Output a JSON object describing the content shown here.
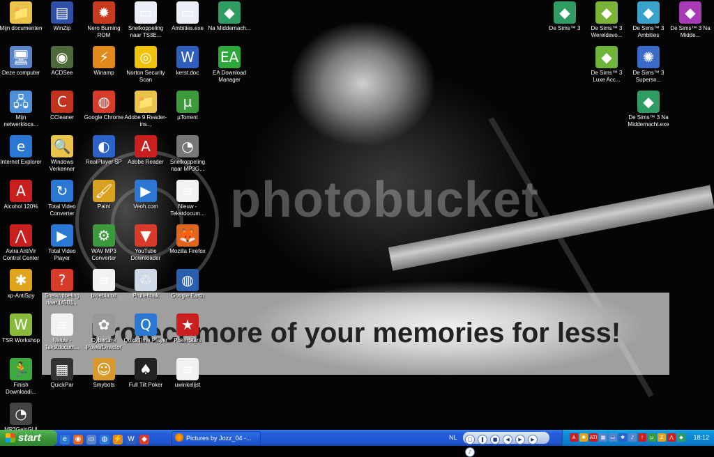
{
  "wallpaper": {
    "watermark": "photobucket",
    "promo": "Protect more of your memories for less!"
  },
  "desktop_icons_left": [
    {
      "name": "mijn-documenten",
      "label": "Mijn documenten",
      "icon": "folder-icon",
      "color": "#e9c34a",
      "glyph": "📁"
    },
    {
      "name": "winzip",
      "label": "WinZip",
      "icon": "winzip-icon",
      "color": "#2f4fa8",
      "glyph": "▤"
    },
    {
      "name": "nero-burning-rom",
      "label": "Nero Burning ROM",
      "icon": "nero-icon",
      "color": "#c83a1e",
      "glyph": "✹"
    },
    {
      "name": "snelkoppeling-ts3e",
      "label": "Snelkoppeling naar TS3E...",
      "icon": "window-icon",
      "color": "#e9eef7",
      "glyph": "▭"
    },
    {
      "name": "ambities-exe",
      "label": "Ambities.exe",
      "icon": "window-icon",
      "color": "#e9eef7",
      "glyph": "▭"
    },
    {
      "name": "na-middernacht",
      "label": "Na Middernach...",
      "icon": "sims-icon",
      "color": "#2f9d63",
      "glyph": "◆"
    },
    {
      "name": "deze-computer",
      "label": "Deze computer",
      "icon": "computer-icon",
      "color": "#5a84c9",
      "glyph": "🖥"
    },
    {
      "name": "acdsee",
      "label": "ACDSee",
      "icon": "acdsee-icon",
      "color": "#4f6a3a",
      "glyph": "◉"
    },
    {
      "name": "winamp",
      "label": "Winamp",
      "icon": "winamp-icon",
      "color": "#e08a1c",
      "glyph": "⚡"
    },
    {
      "name": "norton-security-scan",
      "label": "Norton Security Scan",
      "icon": "norton-icon",
      "color": "#f0c20a",
      "glyph": "◎"
    },
    {
      "name": "kerst-doc",
      "label": "kerst.doc",
      "icon": "word-doc-icon",
      "color": "#2f5fbd",
      "glyph": "W"
    },
    {
      "name": "ea-download-manager",
      "label": "EA Download Manager",
      "icon": "ea-icon",
      "color": "#2ea83a",
      "glyph": "EA"
    },
    {
      "name": "mijn-netwerklocaties",
      "label": "Mijn netwerkloca...",
      "icon": "network-icon",
      "color": "#4d8fd9",
      "glyph": "🖧"
    },
    {
      "name": "ccleaner",
      "label": "CCleaner",
      "icon": "ccleaner-icon",
      "color": "#c2331f",
      "glyph": "C"
    },
    {
      "name": "google-chrome",
      "label": "Google Chrome",
      "icon": "chrome-icon",
      "color": "#d93b2b",
      "glyph": "◍"
    },
    {
      "name": "adobe-9-reader-install",
      "label": "Adobe 9 Reader-ins...",
      "icon": "folder-icon",
      "color": "#e9c34a",
      "glyph": "📁"
    },
    {
      "name": "utorrent",
      "label": "µTorrent",
      "icon": "utorrent-icon",
      "color": "#3c9a3c",
      "glyph": "µ"
    },
    {
      "name": "internet-explorer",
      "label": "Internet Explorer",
      "icon": "ie-icon",
      "color": "#2a78d4",
      "glyph": "e"
    },
    {
      "name": "windows-verkenner",
      "label": "Windows Verkenner",
      "icon": "explorer-icon",
      "color": "#e9c34a",
      "glyph": "🔍"
    },
    {
      "name": "realplayer-sp",
      "label": "RealPlayer SP",
      "icon": "realplayer-icon",
      "color": "#2a62c9",
      "glyph": "◐"
    },
    {
      "name": "adobe-reader",
      "label": "Adobe Reader",
      "icon": "adobe-reader-icon",
      "color": "#c91f1f",
      "glyph": "A"
    },
    {
      "name": "snelkoppeling-mp3g",
      "label": "Snelkoppeling naar MP3G...",
      "icon": "gauge-icon",
      "color": "#777777",
      "glyph": "◔"
    },
    {
      "name": "alcohol-120",
      "label": "Alcohol 120%",
      "icon": "alcohol-icon",
      "color": "#c91f1f",
      "glyph": "A"
    },
    {
      "name": "total-video-converter",
      "label": "Total Video Converter",
      "icon": "converter-icon",
      "color": "#2a78d4",
      "glyph": "↻"
    },
    {
      "name": "paint",
      "label": "Paint",
      "icon": "paint-icon",
      "color": "#d8a11f",
      "glyph": "🖌"
    },
    {
      "name": "veoh-com",
      "label": "Veoh.com",
      "icon": "veoh-icon",
      "color": "#2a78d4",
      "glyph": "▶"
    },
    {
      "name": "nieuw-tekstdocument",
      "label": "Nieuw - Tekstdocum...",
      "icon": "text-doc-icon",
      "color": "#f2f2f2",
      "glyph": "≡"
    },
    {
      "name": "avira-antivir",
      "label": "Avira AntiVir Control Center",
      "icon": "avira-icon",
      "color": "#c91f1f",
      "glyph": "⋀"
    },
    {
      "name": "total-video-player",
      "label": "Total Video Player",
      "icon": "player-icon",
      "color": "#2a78d4",
      "glyph": "▶"
    },
    {
      "name": "wav-mp3-converter",
      "label": "WAV MP3 Converter",
      "icon": "gear-icon",
      "color": "#3c9a3c",
      "glyph": "⚙"
    },
    {
      "name": "youtube-downloader",
      "label": "YouTube Downloader",
      "icon": "youtube-icon",
      "color": "#d93b2b",
      "glyph": "▼"
    },
    {
      "name": "mozilla-firefox",
      "label": "Mozilla Firefox",
      "icon": "firefox-icon",
      "color": "#e2651c",
      "glyph": "🦊"
    },
    {
      "name": "xp-antispy",
      "label": "xp-AntiSpy",
      "icon": "antispy-icon",
      "color": "#e0a51c",
      "glyph": "✱"
    },
    {
      "name": "snelkoppeling-usb",
      "label": "Snelkoppeling naar USB1...",
      "icon": "shortcut-icon",
      "color": "#d93b2b",
      "glyph": "?"
    },
    {
      "name": "bloebla-txt",
      "label": "bloebla.txt",
      "icon": "text-doc-icon",
      "color": "#f2f2f2",
      "glyph": "≡"
    },
    {
      "name": "prullenbak",
      "label": "Prullenbak",
      "icon": "recycle-bin-icon",
      "color": "#cfd8e6",
      "glyph": "♲"
    },
    {
      "name": "google-earth",
      "label": "Google Earth",
      "icon": "earth-icon",
      "color": "#2a5fb0",
      "glyph": "◍"
    },
    {
      "name": "tsr-workshop",
      "label": "TSR Workshop",
      "icon": "workshop-icon",
      "color": "#8aba3a",
      "glyph": "W"
    },
    {
      "name": "nieuw-tekstdocument-2",
      "label": "Nieuw - Tekstdocum...",
      "icon": "text-doc-icon",
      "color": "#f2f2f2",
      "glyph": "≡"
    },
    {
      "name": "cyberlink-powerdirector",
      "label": "CyberLink PowerDirector",
      "icon": "powerdirector-icon",
      "color": "#999999",
      "glyph": "✿"
    },
    {
      "name": "quicktime-player",
      "label": "QuickTime Player",
      "icon": "quicktime-icon",
      "color": "#2a78d4",
      "glyph": "Q"
    },
    {
      "name": "pokerstars",
      "label": "PokerStars",
      "icon": "pokerstars-icon",
      "color": "#c91f1f",
      "glyph": "★"
    },
    {
      "name": "finish-downloading",
      "label": "Finish Downloadi...",
      "icon": "finish-icon",
      "color": "#3caa3c",
      "glyph": "🏃"
    },
    {
      "name": "quickpar",
      "label": "QuickPar",
      "icon": "quickpar-icon",
      "color": "#333333",
      "glyph": "▦"
    },
    {
      "name": "smybots",
      "label": "Smybots",
      "icon": "smybots-icon",
      "color": "#d89a2a",
      "glyph": "☺"
    },
    {
      "name": "full-tilt-poker",
      "label": "Full Tilt Poker",
      "icon": "fulltilt-icon",
      "color": "#222222",
      "glyph": "♠"
    },
    {
      "name": "uwinkelijst",
      "label": "uwinkelijst",
      "icon": "text-doc-icon",
      "color": "#f2f2f2",
      "glyph": "≡"
    },
    {
      "name": "mp3gain",
      "label": "MP3GainGUI",
      "icon": "mp3gain-icon",
      "color": "#444444",
      "glyph": "◔"
    }
  ],
  "desktop_icons_right": [
    {
      "name": "de-sims-3",
      "label": "De Sims™ 3",
      "icon": "sims-icon",
      "color": "#2f9d63",
      "glyph": "◆"
    },
    {
      "name": "de-sims-3-wereldavonturen",
      "label": "De Sims™ 3 Wereldavo...",
      "icon": "sims-icon",
      "color": "#7ab53a",
      "glyph": "◆"
    },
    {
      "name": "de-sims-3-ambities",
      "label": "De Sims™ 3 Ambities",
      "icon": "sims-icon",
      "color": "#3aa3c9",
      "glyph": "◆"
    },
    {
      "name": "de-sims-3-na-middernacht",
      "label": "De Sims™ 3 Na Midde...",
      "icon": "sims-icon",
      "color": "#a83ab5",
      "glyph": "◆"
    },
    {
      "name": "de-sims-3-luxe",
      "label": "De Sims™ 3 Luxe Acc...",
      "icon": "sims-icon",
      "color": "#6fb53a",
      "glyph": "◆"
    },
    {
      "name": "de-sims-3-supersn",
      "label": "De Sims™ 3 Supersn...",
      "icon": "sims-icon",
      "color": "#3a6bc9",
      "glyph": "✺"
    },
    {
      "name": "de-sims-3-na-middernacht-exe",
      "label": "De Sims™ 3 Na Middernacht.exe",
      "icon": "sims-icon",
      "color": "#2f9d63",
      "glyph": "◆"
    }
  ],
  "taskbar": {
    "start_label": "start",
    "task_item": "Pictures by Jozz_04 -...",
    "language": "NL",
    "clock": "18:12",
    "quick_launch": [
      {
        "name": "ql-ie",
        "icon": "ie-icon",
        "color": "#2a78d4",
        "glyph": "e"
      },
      {
        "name": "ql-firefox",
        "icon": "firefox-icon",
        "color": "#e2651c",
        "glyph": "◉"
      },
      {
        "name": "ql-desktop",
        "icon": "desktop-icon",
        "color": "#5a84c9",
        "glyph": "▭"
      },
      {
        "name": "ql-chrome",
        "icon": "chrome-icon",
        "color": "#2a78d4",
        "glyph": "◍"
      },
      {
        "name": "ql-winamp",
        "icon": "winamp-icon",
        "color": "#e08a1c",
        "glyph": "⚡"
      },
      {
        "name": "ql-word",
        "icon": "word-doc-icon",
        "color": "#2f5fbd",
        "glyph": "W"
      },
      {
        "name": "ql-media",
        "icon": "media-icon",
        "color": "#d93b2b",
        "glyph": "◆"
      }
    ],
    "media_controls": [
      {
        "name": "media-restore-icon",
        "glyph": "□"
      },
      {
        "name": "media-pause-icon",
        "glyph": "❚"
      },
      {
        "name": "media-stop-icon",
        "glyph": "■"
      },
      {
        "name": "media-prev-icon",
        "glyph": "◀"
      },
      {
        "name": "media-play-icon",
        "glyph": "▶"
      },
      {
        "name": "media-next-icon",
        "glyph": "▶"
      },
      {
        "name": "media-volume-icon",
        "glyph": "♪"
      }
    ],
    "tray_icons": [
      {
        "name": "tray-alcohol-icon",
        "color": "#c91f1f",
        "glyph": "A"
      },
      {
        "name": "tray-antispy-icon",
        "color": "#e0a51c",
        "glyph": "✱"
      },
      {
        "name": "tray-ati-icon",
        "color": "#c91f1f",
        "glyph": "ATI"
      },
      {
        "name": "tray-network-icon",
        "color": "#5a84c9",
        "glyph": "▦"
      },
      {
        "name": "tray-display-icon",
        "color": "#5a84c9",
        "glyph": "▭"
      },
      {
        "name": "tray-bluetooth-icon",
        "color": "#2a62c9",
        "glyph": "✱"
      },
      {
        "name": "tray-volume-icon",
        "color": "#5a84c9",
        "glyph": "♪"
      },
      {
        "name": "tray-security-icon",
        "color": "#c91f1f",
        "glyph": "!"
      },
      {
        "name": "tray-utorrent-icon",
        "color": "#3c9a3c",
        "glyph": "µ"
      },
      {
        "name": "tray-zonealarm-icon",
        "color": "#e0a51c",
        "glyph": "Z"
      },
      {
        "name": "tray-avira-icon",
        "color": "#c91f1f",
        "glyph": "⋀"
      },
      {
        "name": "tray-sims-icon",
        "color": "#2f9d63",
        "glyph": "◆"
      }
    ]
  }
}
